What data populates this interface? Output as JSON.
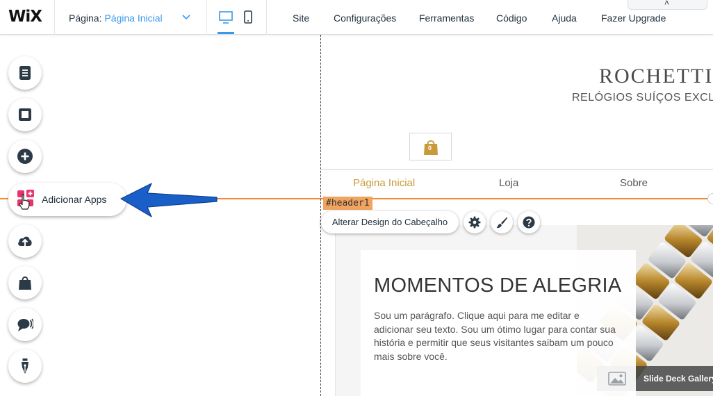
{
  "topbar": {
    "logo": "WiX",
    "page_label": "Página:",
    "page_value": "Página Inicial",
    "menu": [
      "Site",
      "Configurações",
      "Ferramentas",
      "Código",
      "Ajuda",
      "Fazer Upgrade"
    ],
    "collapse_glyph": "˄"
  },
  "sidebar": {
    "add_apps_label": "Adicionar Apps",
    "tools": [
      "pages-icon",
      "background-icon",
      "add-icon",
      "add-apps-icon",
      "upload-icon",
      "store-icon",
      "chat-icon",
      "blog-pen-icon"
    ]
  },
  "site": {
    "title": "ROCHETTI",
    "subtitle": "RELÓGIOS SUÍÇOS EXCLUSIVOS",
    "cart_count": "0",
    "nav": [
      "Página Inicial",
      "Loja",
      "Sobre"
    ],
    "header_tag": "#header1",
    "header_button": "Alterar Design do Cabeçalho",
    "section_title": "MOMENTOS DE ALEGRIA",
    "section_paragraph": "Sou um parágrafo. Clique aqui para me editar e adicionar seu texto.  Sou um ótimo lugar para contar sua história e permitir que seus visitantes saibam um pouco mais sobre você.",
    "gallery_label": "Slide Deck Gallery"
  },
  "colors": {
    "accent_blue": "#3899ec",
    "gold": "#c99a3a",
    "orange_guide": "#f08b36",
    "arrow_blue": "#1a5fc8",
    "icon_dark": "#2b3a46"
  }
}
